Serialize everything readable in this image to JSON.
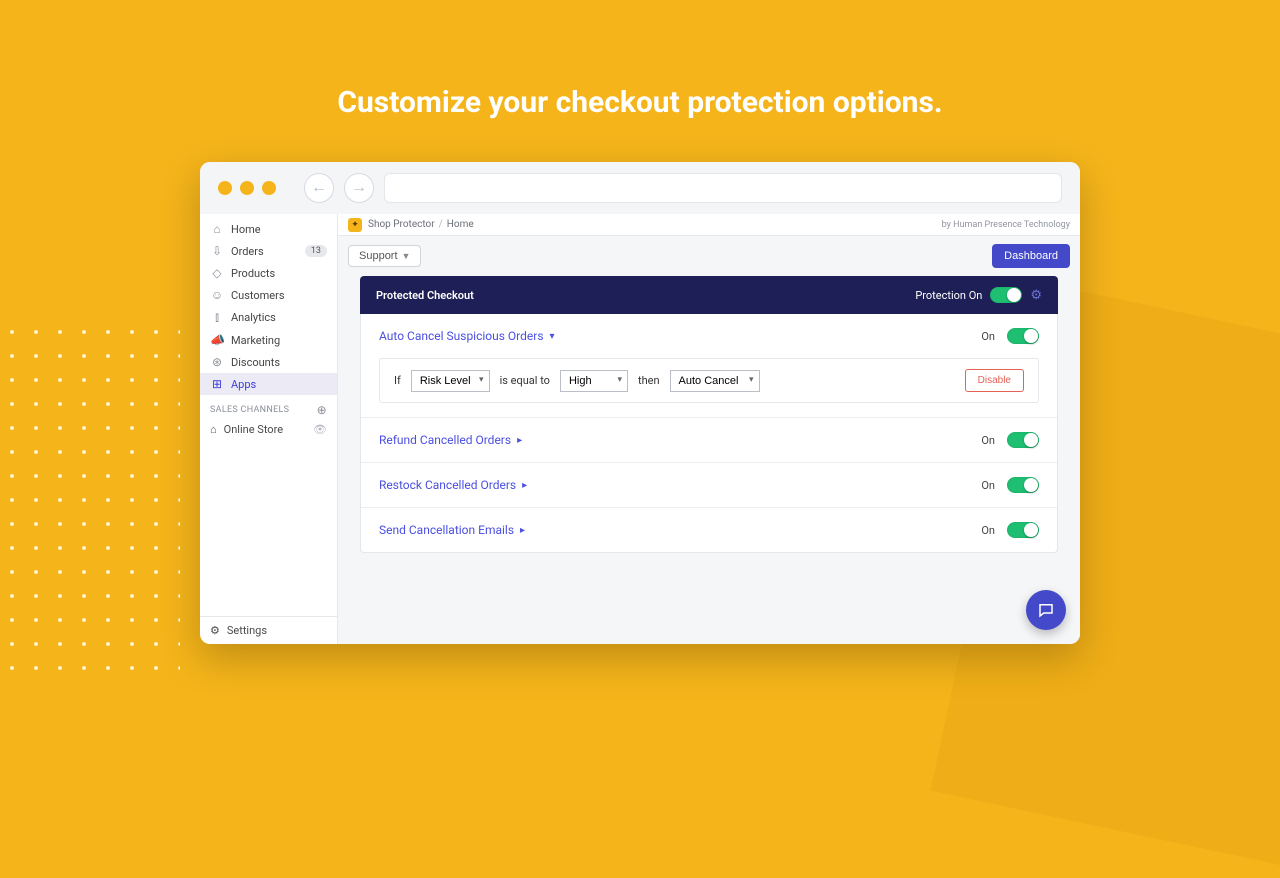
{
  "hero": {
    "title": "Customize your checkout protection options."
  },
  "sidebar": {
    "items": [
      {
        "label": "Home",
        "icon": "⌂"
      },
      {
        "label": "Orders",
        "icon": "⇩",
        "badge": "13"
      },
      {
        "label": "Products",
        "icon": "◇"
      },
      {
        "label": "Customers",
        "icon": "☺"
      },
      {
        "label": "Analytics",
        "icon": "⫾"
      },
      {
        "label": "Marketing",
        "icon": "📣"
      },
      {
        "label": "Discounts",
        "icon": "⊛"
      },
      {
        "label": "Apps",
        "icon": "⊞"
      }
    ],
    "channels_header": "SALES CHANNELS",
    "channels": [
      {
        "label": "Online Store",
        "icon": "⌂"
      }
    ],
    "settings": {
      "label": "Settings",
      "icon": "⚙"
    }
  },
  "topbar": {
    "app": "Shop Protector",
    "crumb": "Home",
    "by": "by Human Presence Technology"
  },
  "toolbar": {
    "support": "Support",
    "dashboard": "Dashboard"
  },
  "panel": {
    "title": "Protected Checkout",
    "protection_label": "Protection On"
  },
  "rules": {
    "r1": {
      "title": "Auto Cancel Suspicious Orders",
      "state": "On",
      "if": "If",
      "field": "Risk Level",
      "op": "is equal to",
      "val": "High",
      "then": "then",
      "action": "Auto Cancel",
      "disable": "Disable"
    },
    "r2": {
      "title": "Refund Cancelled Orders",
      "state": "On"
    },
    "r3": {
      "title": "Restock Cancelled Orders",
      "state": "On"
    },
    "r4": {
      "title": "Send Cancellation Emails",
      "state": "On"
    }
  }
}
